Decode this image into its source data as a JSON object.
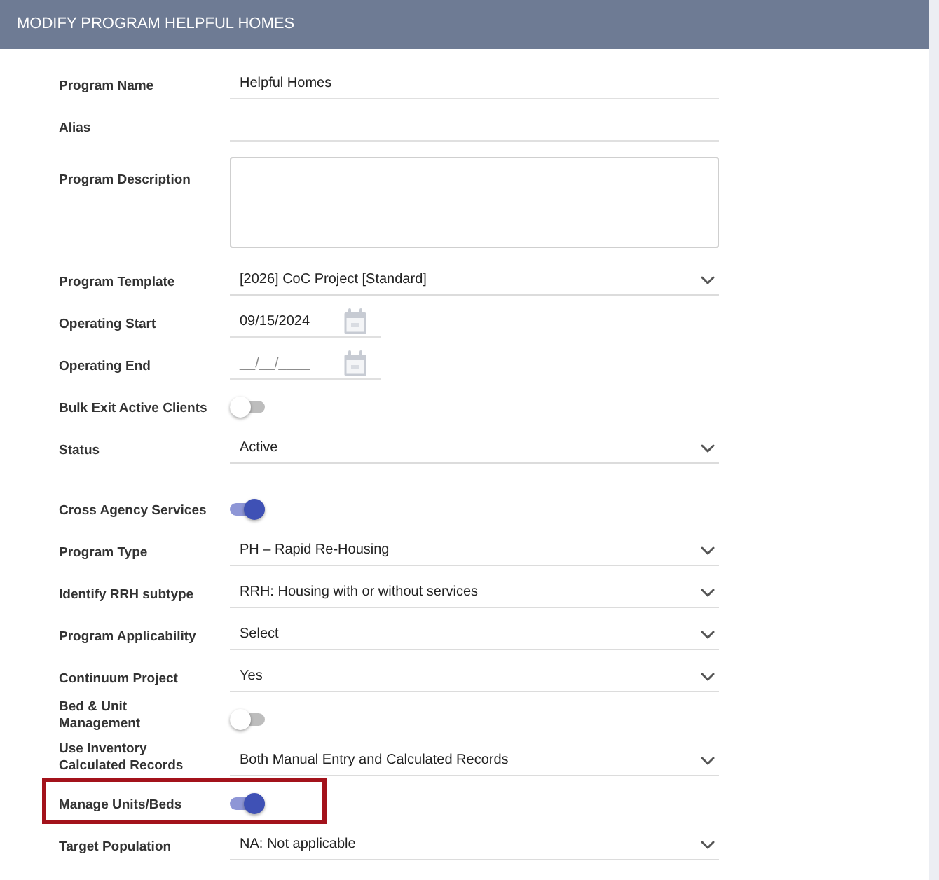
{
  "header": {
    "title": "MODIFY PROGRAM HELPFUL HOMES"
  },
  "sections": [
    {
      "fields": [
        {
          "kind": "text",
          "label": "Program Name",
          "value": "Helpful Homes"
        },
        {
          "kind": "text",
          "label": "Alias"
        },
        {
          "kind": "textarea",
          "label": "Program Description"
        },
        {
          "kind": "select",
          "label": "Program Template",
          "value": "[2026] CoC Project [Standard]"
        },
        {
          "kind": "date",
          "label": "Operating Start",
          "value": "09/15/2024"
        },
        {
          "kind": "date",
          "label": "Operating End",
          "placeholder": "__/__/____"
        },
        {
          "kind": "toggle",
          "label": "Bulk Exit Active Clients",
          "on": false
        },
        {
          "kind": "select",
          "label": "Status",
          "value": "Active"
        }
      ]
    },
    {
      "fields": [
        {
          "kind": "toggle",
          "label": "Cross Agency Services",
          "on": true
        },
        {
          "kind": "select",
          "label": "Program Type",
          "value": "PH – Rapid Re-Housing"
        },
        {
          "kind": "select",
          "label": "Identify RRH subtype",
          "value": "RRH: Housing with or without services"
        },
        {
          "kind": "select",
          "label": "Program Applicability",
          "value": "Select"
        },
        {
          "kind": "select",
          "label": "Continuum Project",
          "value": "Yes"
        },
        {
          "kind": "toggle",
          "label": "Bed & Unit Management",
          "on": false
        },
        {
          "kind": "select",
          "label": "Use Inventory Calculated Records",
          "value": "Both Manual Entry and Calculated Records"
        },
        {
          "kind": "toggle",
          "label": "Manage Units/Beds",
          "on": true,
          "highlighted": true
        },
        {
          "kind": "select",
          "label": "Target Population",
          "value": "NA: Not applicable"
        }
      ]
    }
  ]
}
